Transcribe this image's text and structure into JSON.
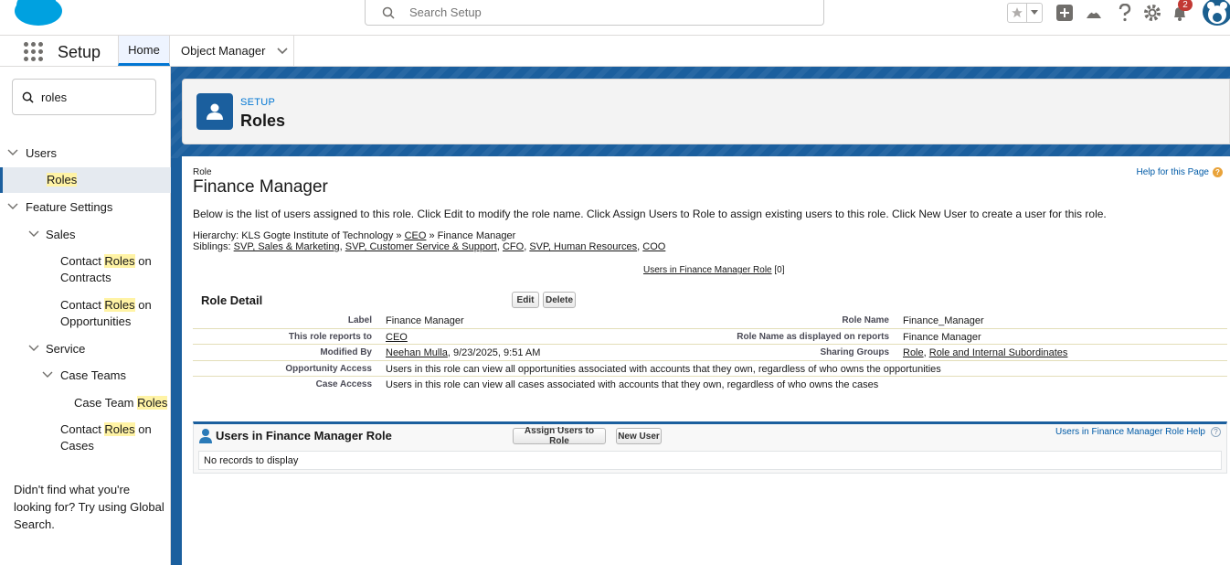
{
  "header": {
    "search_placeholder": "Search Setup",
    "notification_count": "2",
    "icons": [
      "salesforce-logo",
      "search-icon",
      "star-icon",
      "chevron-down-icon",
      "plus-icon",
      "trailhead-icon",
      "help-icon",
      "gear-icon",
      "bell-icon",
      "avatar"
    ]
  },
  "nav": {
    "app_name": "Setup",
    "tabs": [
      {
        "label": "Home"
      },
      {
        "label": "Object Manager"
      }
    ]
  },
  "sidebar": {
    "quickfind_value": "roles",
    "tree": {
      "users": "Users",
      "roles": "Roles",
      "feature_settings": "Feature Settings",
      "sales": "Sales",
      "contact_roles_contracts_a": "Contact ",
      "contact_roles_contracts_hl": "Roles",
      "contact_roles_contracts_b": " on",
      "contact_roles_contracts_c": "Contracts",
      "contact_roles_opps_a": "Contact ",
      "contact_roles_opps_hl": "Roles",
      "contact_roles_opps_b": " on",
      "contact_roles_opps_c": "Opportunities",
      "service": "Service",
      "case_teams": "Case Teams",
      "case_team_roles_a": "Case Team ",
      "case_team_roles_hl": "Roles",
      "contact_roles_cases_a": "Contact ",
      "contact_roles_cases_hl": "Roles",
      "contact_roles_cases_b": " on",
      "contact_roles_cases_c": "Cases"
    },
    "help_text": "Didn't find what you're looking for? Try using Global Search."
  },
  "page_header": {
    "eyebrow": "SETUP",
    "title": "Roles"
  },
  "role": {
    "type_label": "Role",
    "name": "Finance Manager",
    "help_link": "Help for this Page",
    "description": "Below is the list of users assigned to this role. Click Edit to modify the role name. Click Assign Users to Role to assign existing users to this role. Click New User to create a user for this role.",
    "hierarchy_label": "Hierarchy:",
    "hierarchy_org": "KLS Gogte Institute of Technology",
    "hierarchy_sep1": " » ",
    "hierarchy_parent": "CEO",
    "hierarchy_sep2": " » ",
    "hierarchy_current": "Finance Manager",
    "siblings_label": "Siblings:",
    "siblings": [
      "SVP, Sales & Marketing",
      "SVP, Customer Service & Support",
      "CFO",
      "SVP, Human Resources",
      "COO"
    ],
    "users_link": "Users in Finance Manager Role",
    "users_count": "[0]"
  },
  "detail": {
    "title": "Role Detail",
    "edit_label": "Edit",
    "delete_label": "Delete",
    "label_lbl": "Label",
    "label_val": "Finance Manager",
    "role_name_lbl": "Role Name",
    "role_name_val": "Finance_Manager",
    "reports_to_lbl": "This role reports to",
    "reports_to_val": "CEO",
    "display_name_lbl": "Role Name as displayed on reports",
    "display_name_val": "Finance Manager",
    "modified_by_lbl": "Modified By",
    "modified_by_user": "Neehan Mulla",
    "modified_by_date": ", 9/23/2025, 9:51 AM",
    "sharing_groups_lbl": "Sharing Groups",
    "sharing_group_1": "Role",
    "sharing_group_sep": ", ",
    "sharing_group_2": "Role and Internal Subordinates",
    "opp_access_lbl": "Opportunity Access",
    "opp_access_val": "Users in this role can view all opportunities associated with accounts that they own, regardless of who owns the opportunities",
    "case_access_lbl": "Case Access",
    "case_access_val": "Users in this role can view all cases associated with accounts that they own, regardless of who owns the cases"
  },
  "related": {
    "title": "Users in Finance Manager Role",
    "assign_label": "Assign Users to Role",
    "new_user_label": "New User",
    "help_link": "Users in Finance Manager Role Help",
    "empty_text": "No records to display"
  },
  "colors": {
    "brand_blue": "#1b5f9e",
    "salesforce_cloud": "#00a1e0",
    "highlight": "#fff3a5"
  }
}
